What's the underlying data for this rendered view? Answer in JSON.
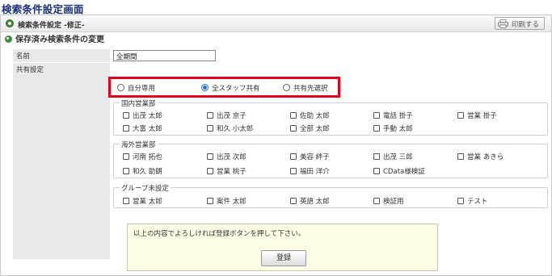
{
  "page": {
    "title": "検索条件設定画面"
  },
  "panel": {
    "header_title": "検索条件設定 -修正-",
    "print_label": "印刷する",
    "section_heading": "保存済み検索条件の変更"
  },
  "form": {
    "name_label": "名前",
    "name_value": "全期間",
    "share_label": "共有設定",
    "share_options": [
      {
        "label": "自分専用",
        "selected": false
      },
      {
        "label": "全スタッフ共有",
        "selected": true
      },
      {
        "label": "共有先選択",
        "selected": false
      }
    ],
    "highlight_color": "#e0001c",
    "radio_color": "#1a73e8"
  },
  "groups": [
    {
      "name": "国内営業部",
      "members": [
        "出茂 太郎",
        "出茂 京子",
        "佐助 太郎",
        "電話 掛子",
        "営業 掛子",
        "大富 太郎",
        "和久 小太郎",
        "全部 太郎",
        "手動 太郎"
      ]
    },
    {
      "name": "海外営業部",
      "members": [
        "河南 拓也",
        "出茂 次郎",
        "美容 絆子",
        "出茂 三郎",
        "営業 あきら",
        "和久 助朗",
        "営業 桃子",
        "福田 洋介",
        "CData様検証"
      ]
    },
    {
      "name": "グループ未設定",
      "members": [
        "営業 太郎",
        "案件 太郎",
        "英語 太郎",
        "検証用",
        "テスト"
      ]
    }
  ],
  "notice": {
    "text": "以上の内容でよろしければ登録ボタンを押して下さい。",
    "register_label": "登録"
  }
}
